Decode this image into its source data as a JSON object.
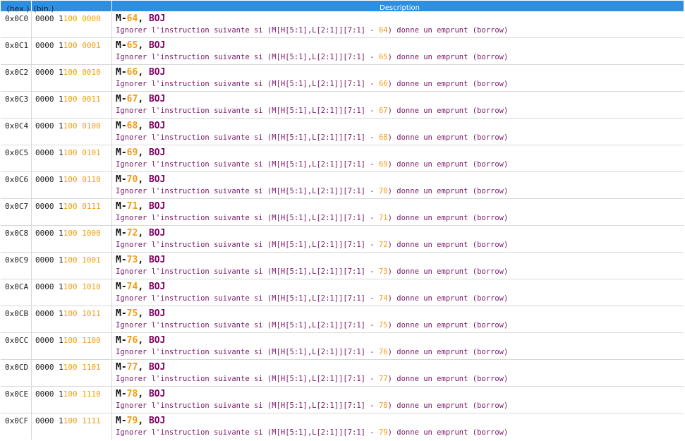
{
  "header": {
    "hex": "(hex.)",
    "bin": "(bin.)",
    "desc": "Description"
  },
  "colors": {
    "header_bg": "#2e8fe0",
    "highlight": "#f39c12",
    "op": "#800060",
    "desc_text": "#7a1a6a"
  },
  "rows": [
    {
      "hex": "0x0C0",
      "bin_a": "0000 1",
      "bin_b": "100 0000",
      "mnem_pre": "M-",
      "mnem_num": "64",
      "mnem_sep": ", ",
      "mnem_op": "BOJ",
      "desc_pre": "Ignorer l'instruction suivante si (M[H[5:1],L[2:1]][7:1] - ",
      "desc_num": "64",
      "desc_post": ") donne un emprunt (borrow)"
    },
    {
      "hex": "0x0C1",
      "bin_a": "0000 1",
      "bin_b": "100 0001",
      "mnem_pre": "M-",
      "mnem_num": "65",
      "mnem_sep": ", ",
      "mnem_op": "BOJ",
      "desc_pre": "Ignorer l'instruction suivante si (M[H[5:1],L[2:1]][7:1] - ",
      "desc_num": "65",
      "desc_post": ") donne un emprunt (borrow)"
    },
    {
      "hex": "0x0C2",
      "bin_a": "0000 1",
      "bin_b": "100 0010",
      "mnem_pre": "M-",
      "mnem_num": "66",
      "mnem_sep": ", ",
      "mnem_op": "BOJ",
      "desc_pre": "Ignorer l'instruction suivante si (M[H[5:1],L[2:1]][7:1] - ",
      "desc_num": "66",
      "desc_post": ") donne un emprunt (borrow)"
    },
    {
      "hex": "0x0C3",
      "bin_a": "0000 1",
      "bin_b": "100 0011",
      "mnem_pre": "M-",
      "mnem_num": "67",
      "mnem_sep": ", ",
      "mnem_op": "BOJ",
      "desc_pre": "Ignorer l'instruction suivante si (M[H[5:1],L[2:1]][7:1] - ",
      "desc_num": "67",
      "desc_post": ") donne un emprunt (borrow)"
    },
    {
      "hex": "0x0C4",
      "bin_a": "0000 1",
      "bin_b": "100 0100",
      "mnem_pre": "M-",
      "mnem_num": "68",
      "mnem_sep": ", ",
      "mnem_op": "BOJ",
      "desc_pre": "Ignorer l'instruction suivante si (M[H[5:1],L[2:1]][7:1] - ",
      "desc_num": "68",
      "desc_post": ") donne un emprunt (borrow)"
    },
    {
      "hex": "0x0C5",
      "bin_a": "0000 1",
      "bin_b": "100 0101",
      "mnem_pre": "M-",
      "mnem_num": "69",
      "mnem_sep": ", ",
      "mnem_op": "BOJ",
      "desc_pre": "Ignorer l'instruction suivante si (M[H[5:1],L[2:1]][7:1] - ",
      "desc_num": "69",
      "desc_post": ") donne un emprunt (borrow)"
    },
    {
      "hex": "0x0C6",
      "bin_a": "0000 1",
      "bin_b": "100 0110",
      "mnem_pre": "M-",
      "mnem_num": "70",
      "mnem_sep": ", ",
      "mnem_op": "BOJ",
      "desc_pre": "Ignorer l'instruction suivante si (M[H[5:1],L[2:1]][7:1] - ",
      "desc_num": "70",
      "desc_post": ") donne un emprunt (borrow)"
    },
    {
      "hex": "0x0C7",
      "bin_a": "0000 1",
      "bin_b": "100 0111",
      "mnem_pre": "M-",
      "mnem_num": "71",
      "mnem_sep": ", ",
      "mnem_op": "BOJ",
      "desc_pre": "Ignorer l'instruction suivante si (M[H[5:1],L[2:1]][7:1] - ",
      "desc_num": "71",
      "desc_post": ") donne un emprunt (borrow)"
    },
    {
      "hex": "0x0C8",
      "bin_a": "0000 1",
      "bin_b": "100 1000",
      "mnem_pre": "M-",
      "mnem_num": "72",
      "mnem_sep": ", ",
      "mnem_op": "BOJ",
      "desc_pre": "Ignorer l'instruction suivante si (M[H[5:1],L[2:1]][7:1] - ",
      "desc_num": "72",
      "desc_post": ") donne un emprunt (borrow)"
    },
    {
      "hex": "0x0C9",
      "bin_a": "0000 1",
      "bin_b": "100 1001",
      "mnem_pre": "M-",
      "mnem_num": "73",
      "mnem_sep": ", ",
      "mnem_op": "BOJ",
      "desc_pre": "Ignorer l'instruction suivante si (M[H[5:1],L[2:1]][7:1] - ",
      "desc_num": "73",
      "desc_post": ") donne un emprunt (borrow)"
    },
    {
      "hex": "0x0CA",
      "bin_a": "0000 1",
      "bin_b": "100 1010",
      "mnem_pre": "M-",
      "mnem_num": "74",
      "mnem_sep": ", ",
      "mnem_op": "BOJ",
      "desc_pre": "Ignorer l'instruction suivante si (M[H[5:1],L[2:1]][7:1] - ",
      "desc_num": "74",
      "desc_post": ") donne un emprunt (borrow)"
    },
    {
      "hex": "0x0CB",
      "bin_a": "0000 1",
      "bin_b": "100 1011",
      "mnem_pre": "M-",
      "mnem_num": "75",
      "mnem_sep": ", ",
      "mnem_op": "BOJ",
      "desc_pre": "Ignorer l'instruction suivante si (M[H[5:1],L[2:1]][7:1] - ",
      "desc_num": "75",
      "desc_post": ") donne un emprunt (borrow)"
    },
    {
      "hex": "0x0CC",
      "bin_a": "0000 1",
      "bin_b": "100 1100",
      "mnem_pre": "M-",
      "mnem_num": "76",
      "mnem_sep": ", ",
      "mnem_op": "BOJ",
      "desc_pre": "Ignorer l'instruction suivante si (M[H[5:1],L[2:1]][7:1] - ",
      "desc_num": "76",
      "desc_post": ") donne un emprunt (borrow)"
    },
    {
      "hex": "0x0CD",
      "bin_a": "0000 1",
      "bin_b": "100 1101",
      "mnem_pre": "M-",
      "mnem_num": "77",
      "mnem_sep": ", ",
      "mnem_op": "BOJ",
      "desc_pre": "Ignorer l'instruction suivante si (M[H[5:1],L[2:1]][7:1] - ",
      "desc_num": "77",
      "desc_post": ") donne un emprunt (borrow)"
    },
    {
      "hex": "0x0CE",
      "bin_a": "0000 1",
      "bin_b": "100 1110",
      "mnem_pre": "M-",
      "mnem_num": "78",
      "mnem_sep": ", ",
      "mnem_op": "BOJ",
      "desc_pre": "Ignorer l'instruction suivante si (M[H[5:1],L[2:1]][7:1] - ",
      "desc_num": "78",
      "desc_post": ") donne un emprunt (borrow)"
    },
    {
      "hex": "0x0CF",
      "bin_a": "0000 1",
      "bin_b": "100 1111",
      "mnem_pre": "M-",
      "mnem_num": "79",
      "mnem_sep": ", ",
      "mnem_op": "BOJ",
      "desc_pre": "Ignorer l'instruction suivante si (M[H[5:1],L[2:1]][7:1] - ",
      "desc_num": "79",
      "desc_post": ") donne un emprunt (borrow)"
    }
  ]
}
